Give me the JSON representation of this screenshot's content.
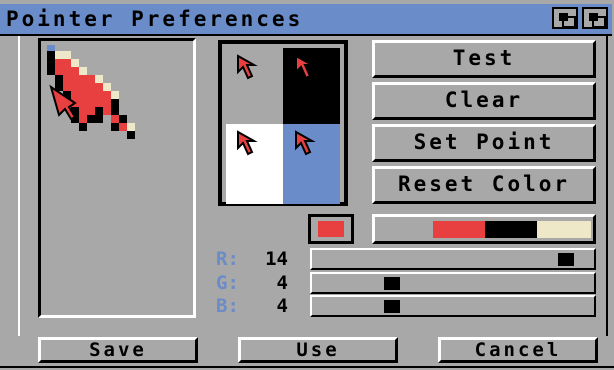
{
  "window": {
    "title": "Pointer Preferences"
  },
  "buttons": {
    "test": "Test",
    "clear": "Clear",
    "set_point": "Set Point",
    "reset_color": "Reset Color"
  },
  "rgb": {
    "r_label": "R",
    "g_label": "G",
    "b_label": "B",
    "r": "14",
    "g": "4",
    "b": "4",
    "max": 15
  },
  "footer": {
    "save": "Save",
    "use": "Use",
    "cancel": "Cancel"
  },
  "colors": {
    "title_bar": "#6a8cc8",
    "background": "#a8a8a8",
    "pointer_red": "#e84040",
    "pointer_black": "#000000",
    "pointer_cream": "#efe8c8",
    "preview_blue": "#6a8cc8",
    "preview_white": "#ffffff"
  },
  "icons": [
    "depth-gadget-icon",
    "zoom-gadget-icon",
    "pointer-arrow-icon"
  ]
}
